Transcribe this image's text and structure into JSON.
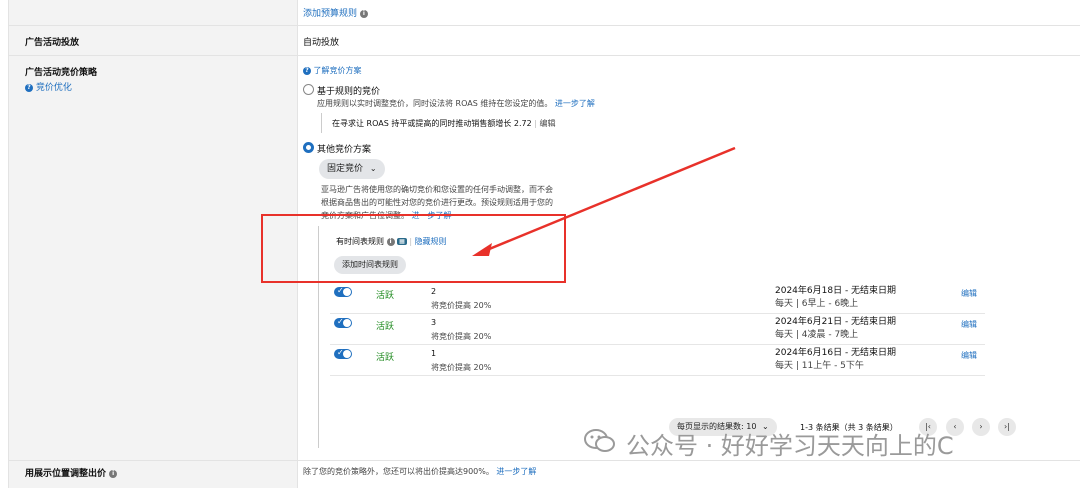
{
  "top": {
    "add_budget_rule": "添加预算规则"
  },
  "sections": {
    "delivery": {
      "label": "广告活动投放",
      "value": "自动投放"
    },
    "strategy": {
      "label": "广告活动竞价策略",
      "optimize_link": "竞价优化",
      "learn_link": "了解竞价方案",
      "rule_based": {
        "title": "基于规则的竞价",
        "desc": "应用规则以实时调整竞价，同时设法将 ROAS 维持在您设定的值。",
        "desc_link": "进一步了解",
        "current": "在寻求让 ROAS 持平或提高的同时推动销售额增长 2.72",
        "edit": "编辑"
      },
      "other": {
        "title": "其他竞价方案",
        "dropdown": "固定竞价",
        "desc1": "亚马逊广告将使用您的确切竞价和您设置的任何手动调整，而不会",
        "desc2": "根据商品售出的可能性对您的竞价进行更改。预设规则适用于您的",
        "desc3": "竞价方案和广告位调整。",
        "desc_link": "进一步了解",
        "schedule_label": "有时间表规则",
        "hide_rules": "隐藏规则",
        "add_schedule": "添加时间表规则"
      }
    },
    "placement": {
      "label": "用展示位置调整出价",
      "desc": "除了您的竞价策略外，您还可以将出价提高达900%。",
      "link": "进一步了解"
    }
  },
  "rules": [
    {
      "status": "活跃",
      "name": "2",
      "adjust": "将竞价提高 20%",
      "date": "2024年6月18日 - 无结束日期",
      "time": "每天 | 6早上 - 6晚上",
      "edit": "编辑"
    },
    {
      "status": "活跃",
      "name": "3",
      "adjust": "将竞价提高 20%",
      "date": "2024年6月21日 - 无结束日期",
      "time": "每天 | 4凌晨 - 7晚上",
      "edit": "编辑"
    },
    {
      "status": "活跃",
      "name": "1",
      "adjust": "将竞价提高 20%",
      "date": "2024年6月16日 - 无结束日期",
      "time": "每天 | 11上午 - 5下午",
      "edit": "编辑"
    }
  ],
  "pagination": {
    "per_page_label": "每页显示的结果数: ",
    "per_page_value": "10",
    "range": "1-3 条结果（共 3 条结果）"
  },
  "watermark": "公众号 · 好好学习天天向上的C",
  "colors": {
    "link": "#1f6fbf",
    "active": "#1f8a1f",
    "annotation": "#e8312a"
  }
}
